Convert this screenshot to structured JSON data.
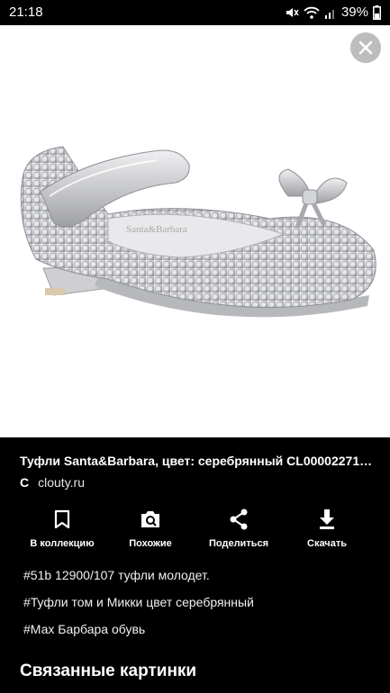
{
  "status_bar": {
    "time": "21:18",
    "battery": "39%",
    "icons": [
      "mute-icon",
      "wifi-icon",
      "signal-icon",
      "battery-icon"
    ]
  },
  "viewer": {
    "close_icon": "close-icon",
    "image_subject": "silver sequin girls shoe with bow"
  },
  "details": {
    "title": "Туфли Santa&Barbara, цвет: серебрянный CL00002271…",
    "source_logo": "C",
    "source": "clouty.ru"
  },
  "actions": [
    {
      "label": "В коллекцию",
      "icon": "bookmark-icon"
    },
    {
      "label": "Похожие",
      "icon": "camera-search-icon"
    },
    {
      "label": "Поделиться",
      "icon": "share-icon"
    },
    {
      "label": "Скачать",
      "icon": "download-icon"
    }
  ],
  "tags": [
    "#51b 12900/107 туфли молодет.",
    "#Туфли том и Микки цвет серебрянный",
    "#Мах Барбара обувь"
  ],
  "related_heading": "Связанные картинки",
  "colors": {
    "background": "#000000",
    "image_background": "#ffffff",
    "close_button": "#bdbdbd",
    "text": "#ffffff"
  }
}
